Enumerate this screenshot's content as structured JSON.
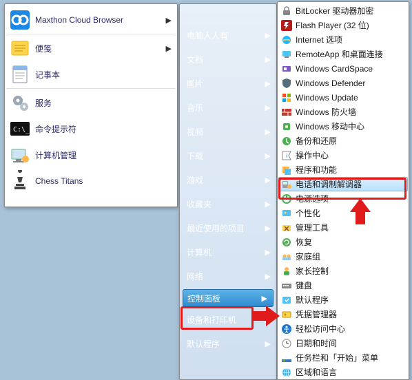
{
  "left_panel": {
    "items": [
      {
        "label": "Maxthon Cloud Browser",
        "has_arrow": true,
        "icon": "maxthon"
      },
      {
        "label": "便笺",
        "has_arrow": true,
        "icon": "notes"
      },
      {
        "label": "记事本",
        "has_arrow": false,
        "icon": "notepad"
      },
      {
        "label": "服务",
        "has_arrow": false,
        "icon": "gears"
      },
      {
        "label": "命令提示符",
        "has_arrow": false,
        "icon": "cmd"
      },
      {
        "label": "计算机管理",
        "has_arrow": false,
        "icon": "compmgmt"
      },
      {
        "label": "Chess Titans",
        "has_arrow": false,
        "icon": "chess"
      }
    ]
  },
  "mid_panel": {
    "items": [
      "电脑人人有",
      "文档",
      "图片",
      "音乐",
      "视频",
      "下载",
      "游戏",
      "收藏夹",
      "最近使用的项目",
      "计算机",
      "网络",
      "控制面板",
      "设备和打印机",
      "默认程序"
    ],
    "highlight_index": 11
  },
  "right_panel": {
    "items": [
      "BitLocker 驱动器加密",
      "Flash Player (32 位)",
      "Internet 选项",
      "RemoteApp 和桌面连接",
      "Windows CardSpace",
      "Windows Defender",
      "Windows Update",
      "Windows 防火墙",
      "Windows 移动中心",
      "备份和还原",
      "操作中心",
      "程序和功能",
      "电话和调制解调器",
      "电源选项",
      "个性化",
      "管理工具",
      "恢复",
      "家庭组",
      "家长控制",
      "键盘",
      "默认程序",
      "凭据管理器",
      "轻松访问中心",
      "日期和时间",
      "任务栏和「开始」菜单",
      "区域和语言"
    ],
    "hover_index": 12,
    "icons": [
      "bitlocker",
      "flash",
      "ie",
      "remote",
      "cardspace",
      "defender",
      "winupdate",
      "firewall",
      "mobility",
      "backup",
      "action",
      "programs",
      "phone",
      "power",
      "personalize",
      "admintools",
      "recovery",
      "homegroup",
      "parental",
      "keyboard",
      "defaultprog",
      "credential",
      "ease",
      "datetime",
      "taskbar",
      "region"
    ]
  }
}
